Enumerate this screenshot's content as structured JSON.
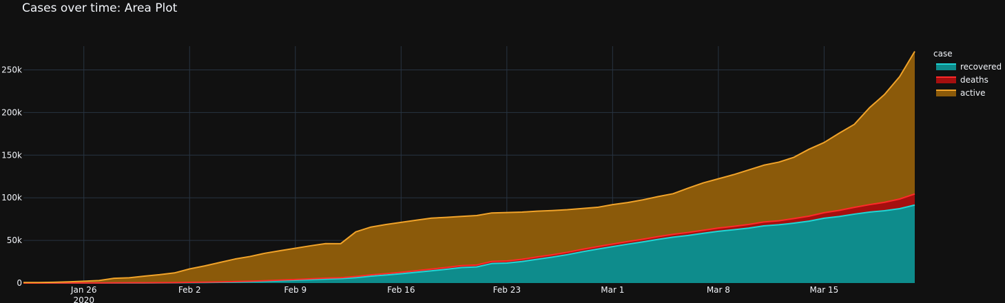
{
  "chart_data": {
    "type": "area",
    "title": "Cases over time: Area Plot",
    "xlabel": "",
    "ylabel": "",
    "x_range": [
      "2020-01-22",
      "2020-03-21"
    ],
    "ylim": [
      0,
      290000
    ],
    "x_ticks": [
      {
        "date": "2020-01-26",
        "label": "Jan 26",
        "sublabel": "2020"
      },
      {
        "date": "2020-02-02",
        "label": "Feb 2"
      },
      {
        "date": "2020-02-09",
        "label": "Feb 9"
      },
      {
        "date": "2020-02-16",
        "label": "Feb 16"
      },
      {
        "date": "2020-02-23",
        "label": "Feb 23"
      },
      {
        "date": "2020-03-01",
        "label": "Mar 1"
      },
      {
        "date": "2020-03-08",
        "label": "Mar 8"
      },
      {
        "date": "2020-03-15",
        "label": "Mar 15"
      }
    ],
    "y_ticks": [
      {
        "value": 0,
        "label": "0"
      },
      {
        "value": 50000,
        "label": "50k"
      },
      {
        "value": 100000,
        "label": "100k"
      },
      {
        "value": 150000,
        "label": "150k"
      },
      {
        "value": 200000,
        "label": "200k"
      },
      {
        "value": 250000,
        "label": "250k"
      }
    ],
    "stacked": true,
    "grid": true,
    "legend_position": "top-right",
    "legend_title": "case",
    "x": [
      "2020-01-22",
      "2020-01-23",
      "2020-01-24",
      "2020-01-25",
      "2020-01-26",
      "2020-01-27",
      "2020-01-28",
      "2020-01-29",
      "2020-01-30",
      "2020-01-31",
      "2020-02-01",
      "2020-02-02",
      "2020-02-03",
      "2020-02-04",
      "2020-02-05",
      "2020-02-06",
      "2020-02-07",
      "2020-02-08",
      "2020-02-09",
      "2020-02-10",
      "2020-02-11",
      "2020-02-12",
      "2020-02-13",
      "2020-02-14",
      "2020-02-15",
      "2020-02-16",
      "2020-02-17",
      "2020-02-18",
      "2020-02-19",
      "2020-02-20",
      "2020-02-21",
      "2020-02-22",
      "2020-02-23",
      "2020-02-24",
      "2020-02-25",
      "2020-02-26",
      "2020-02-27",
      "2020-02-28",
      "2020-02-29",
      "2020-03-01",
      "2020-03-02",
      "2020-03-03",
      "2020-03-04",
      "2020-03-05",
      "2020-03-06",
      "2020-03-07",
      "2020-03-08",
      "2020-03-09",
      "2020-03-10",
      "2020-03-11",
      "2020-03-12",
      "2020-03-13",
      "2020-03-14",
      "2020-03-15",
      "2020-03-16",
      "2020-03-17",
      "2020-03-18",
      "2020-03-19",
      "2020-03-20",
      "2020-03-21"
    ],
    "series": [
      {
        "name": "recovered",
        "color": "#0e8c8c",
        "line_color": "#1fd6d6",
        "values": [
          28,
          30,
          36,
          39,
          52,
          61,
          107,
          126,
          143,
          222,
          284,
          472,
          623,
          852,
          1124,
          1487,
          2011,
          2616,
          3244,
          3946,
          4683,
          5150,
          6295,
          8058,
          9395,
          10865,
          12583,
          14352,
          16121,
          18177,
          18890,
          22886,
          23394,
          25227,
          27905,
          30384,
          33277,
          36711,
          39782,
          42716,
          45602,
          48229,
          51170,
          53796,
          55865,
          58358,
          60694,
          62494,
          64404,
          67003,
          68324,
          70251,
          72624,
          76034,
          78088,
          80840,
          83207,
          84854,
          87256,
          91499
        ]
      },
      {
        "name": "deaths",
        "color": "#a50f0f",
        "line_color": "#ff2a2a",
        "values": [
          17,
          18,
          26,
          42,
          56,
          82,
          131,
          133,
          171,
          213,
          259,
          362,
          426,
          492,
          564,
          634,
          719,
          806,
          906,
          1013,
          1113,
          1118,
          1371,
          1523,
          1666,
          1770,
          1868,
          2007,
          2122,
          2247,
          2251,
          2458,
          2469,
          2629,
          2708,
          2770,
          2814,
          2872,
          2941,
          2996,
          3085,
          3160,
          3254,
          3348,
          3460,
          3558,
          3802,
          3988,
          4262,
          4615,
          4720,
          5404,
          5819,
          6440,
          7126,
          7905,
          8733,
          9867,
          11299,
          13000
        ]
      },
      {
        "name": "active",
        "color": "#8b5a0a",
        "line_color": "#f2a42a",
        "values": [
          510,
          606,
          879,
          1353,
          2010,
          2784,
          5340,
          5860,
          7737,
          9323,
          11342,
          15739,
          19050,
          22774,
          26446,
          29035,
          32263,
          34539,
          36620,
          38714,
          40444,
          39902,
          52386,
          56065,
          57591,
          58563,
          59300,
          59816,
          58769,
          57702,
          57995,
          56886,
          56873,
          55355,
          53710,
          51860,
          49903,
          47855,
          46096,
          46286,
          45733,
          46209,
          46924,
          47603,
          52018,
          55554,
          57780,
          60622,
          63955,
          66596,
          68776,
          71836,
          78520,
          82360,
          90570,
          97400,
          113600,
          126500,
          143600,
          167200
        ]
      }
    ]
  }
}
